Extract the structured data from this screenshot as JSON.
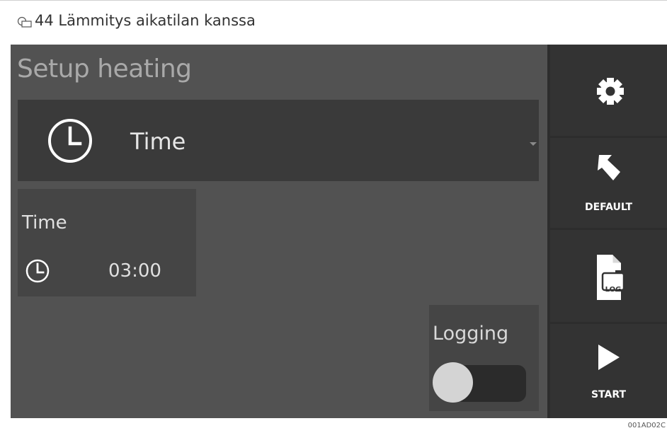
{
  "figure": {
    "caption": "44 Lämmitys aikatilan kanssa",
    "image_code": "001AD02C",
    "caption_icon": "document-tab-icon"
  },
  "screen": {
    "title": "Setup heating",
    "mode_dropdown": {
      "label": "Time",
      "icon": "clock-icon"
    },
    "time_card": {
      "label": "Time",
      "value": "03:00",
      "icon": "clock-icon"
    },
    "logging": {
      "label": "Logging",
      "enabled": false
    },
    "sidebar": {
      "settings": {
        "icon": "gear-icon"
      },
      "default": {
        "icon": "return-arrow-icon",
        "label": "DEFAULT"
      },
      "log": {
        "icon": "log-file-icon",
        "badge": "LOG"
      },
      "start": {
        "icon": "play-icon",
        "label": "START"
      }
    }
  },
  "colors": {
    "screen_background": "#525252",
    "dropdown_background": "#3a3a3a",
    "card_background": "#454545",
    "sidebar_background": "#2d2d2d",
    "title_text": "#a9a9a9",
    "primary_text": "#e6e6e6"
  }
}
